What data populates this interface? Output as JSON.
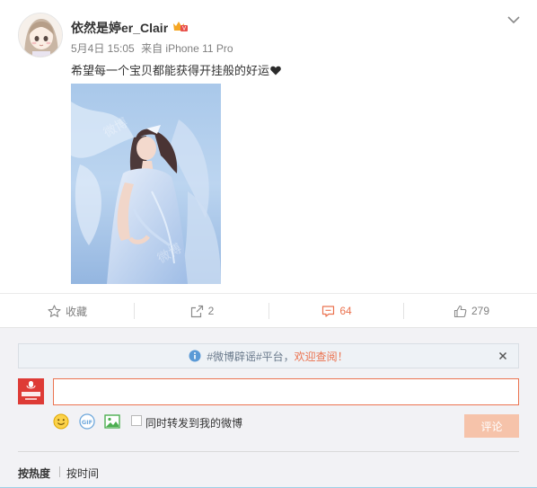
{
  "post": {
    "username": "依然是婷er_Clair",
    "date": "5月4日 15:05",
    "source": "来自 iPhone 11 Pro",
    "text": "希望每一个宝贝都能获得开挂般的好运",
    "icons": {
      "avatar": "girl-avatar",
      "badge": "vip-crown-icon",
      "more": "chevron-down-icon",
      "heart": "black-heart-icon"
    }
  },
  "actions": {
    "favorite_label": "收藏",
    "repost_count": "2",
    "comment_count": "64",
    "like_count": "279"
  },
  "comment": {
    "notice_topic": "#微博辟谣#平台，",
    "notice_link": "欢迎查阅！",
    "input_value": "",
    "repost_label": "同时转发到我的微博",
    "submit_label": "评论",
    "sort_hot": "按热度",
    "sort_time": "按时间"
  },
  "colors": {
    "accent": "#eb7350",
    "submit_disabled": "#f6c3aa",
    "notice_bg": "#eef2f6"
  }
}
